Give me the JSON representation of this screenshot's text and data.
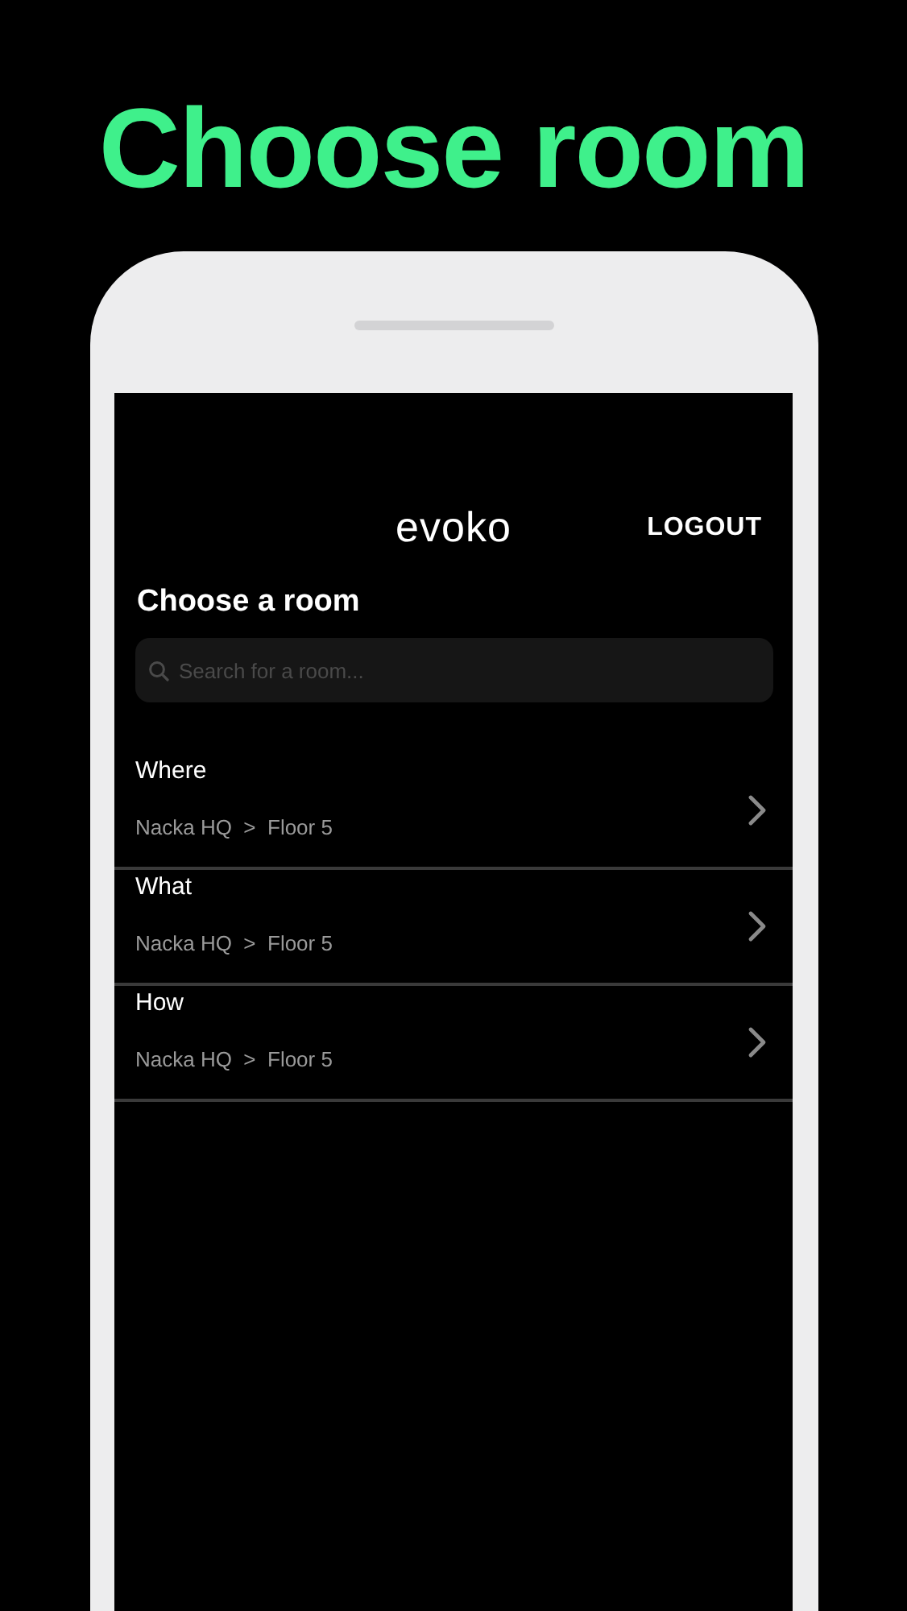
{
  "headline": "Choose room",
  "app": {
    "logo": "evoko",
    "logout": "LOGOUT"
  },
  "section_title": "Choose a room",
  "search": {
    "placeholder": "Search for a room..."
  },
  "rooms": [
    {
      "name": "Where",
      "location": "Nacka HQ  >  Floor 5"
    },
    {
      "name": "What",
      "location": "Nacka HQ  >  Floor 5"
    },
    {
      "name": "How",
      "location": "Nacka HQ  >  Floor 5"
    }
  ]
}
